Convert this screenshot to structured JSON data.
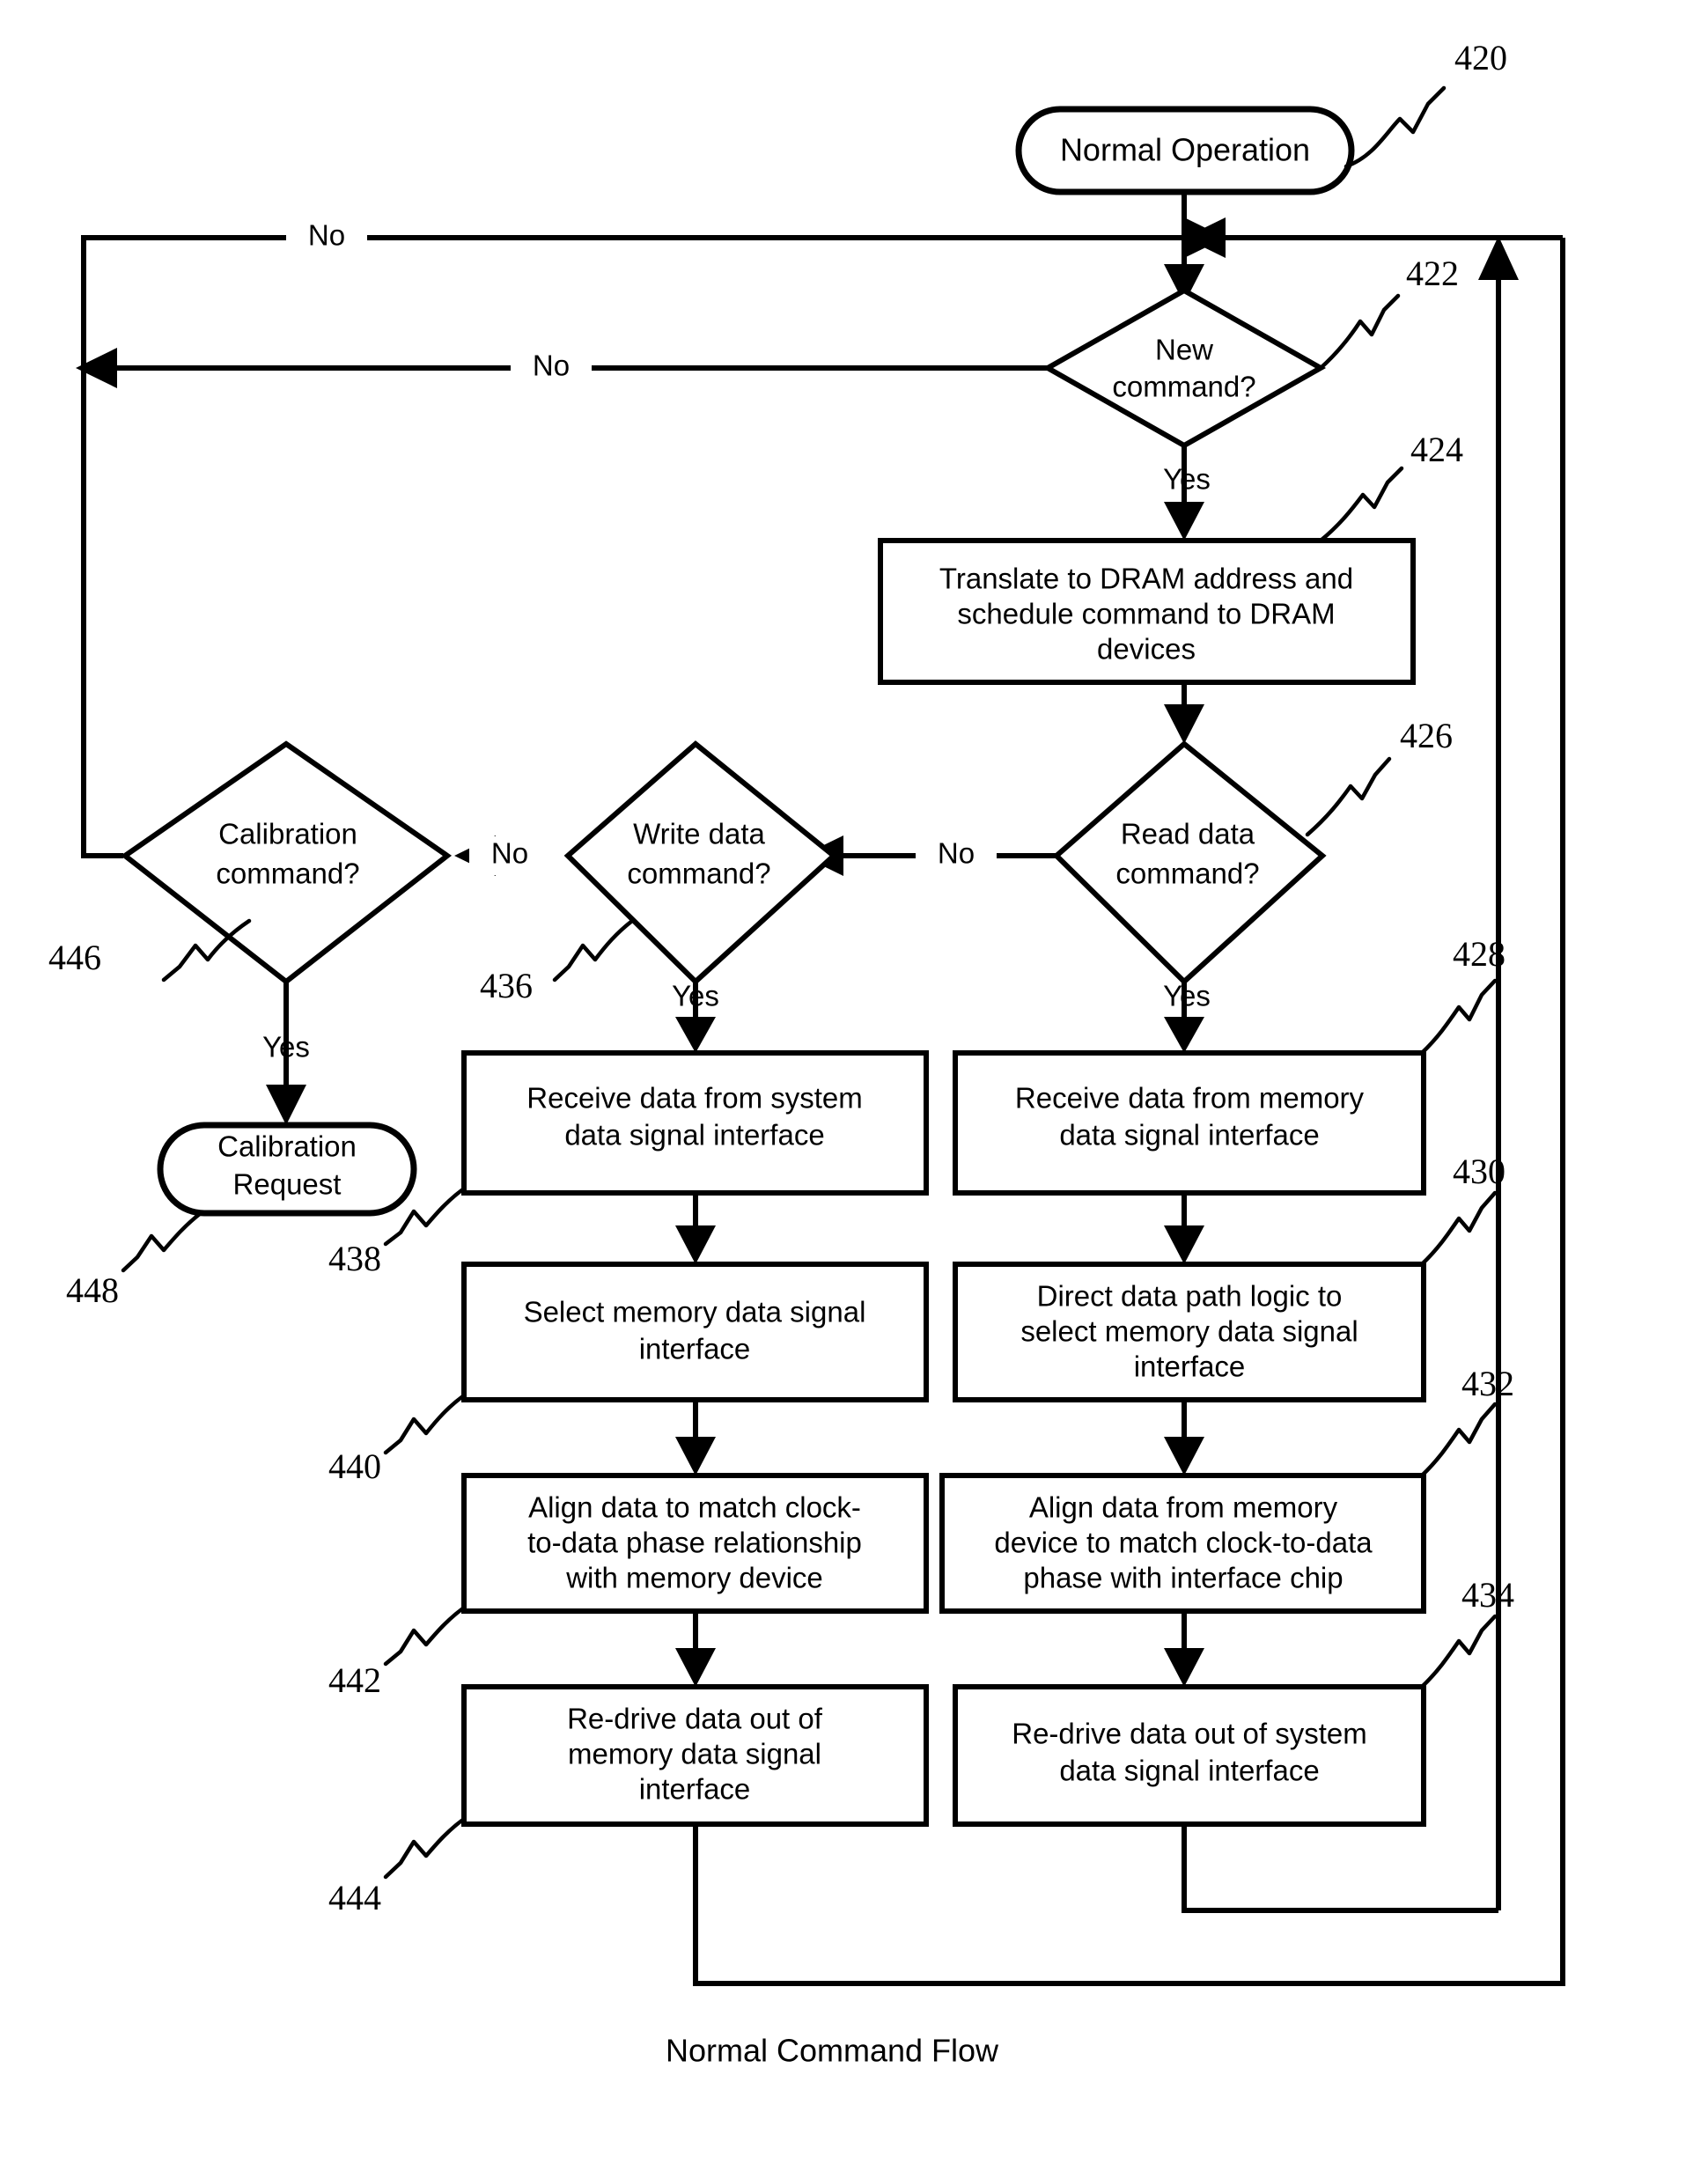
{
  "figure": {
    "caption": "Normal Command Flow",
    "edge_labels": {
      "no": "No",
      "yes": "Yes"
    }
  },
  "nodes": {
    "normal_operation": {
      "label": "Normal Operation",
      "ref": "420",
      "shape": "terminator"
    },
    "new_command": {
      "label_line1": "New",
      "label_line2": "command?",
      "ref": "422",
      "shape": "decision"
    },
    "translate": {
      "label_line1": "Translate to DRAM address and",
      "label_line2": "schedule command to DRAM",
      "label_line3": "devices",
      "ref": "424",
      "shape": "process"
    },
    "read_data_command": {
      "label_line1": "Read data",
      "label_line2": "command?",
      "ref": "426",
      "shape": "decision"
    },
    "write_data_command": {
      "label_line1": "Write data",
      "label_line2": "command?",
      "ref": "436",
      "shape": "decision"
    },
    "calibration_command": {
      "label_line1": "Calibration",
      "label_line2": "command?",
      "ref": "446",
      "shape": "decision"
    },
    "calibration_request": {
      "label_line1": "Calibration",
      "label_line2": "Request",
      "ref": "448",
      "shape": "terminator"
    },
    "receive_memory": {
      "label_line1": "Receive data from memory",
      "label_line2": "data signal interface",
      "ref": "428",
      "shape": "process"
    },
    "direct_path": {
      "label_line1": "Direct data path logic to",
      "label_line2": "select memory data signal",
      "label_line3": "interface",
      "ref": "430",
      "shape": "process"
    },
    "align_memory": {
      "label_line1": "Align data from memory",
      "label_line2": "device to match clock-to-data",
      "label_line3": "phase with interface chip",
      "ref": "432",
      "shape": "process"
    },
    "redrive_system": {
      "label_line1": "Re-drive data out of system",
      "label_line2": "data signal interface",
      "ref": "434",
      "shape": "process"
    },
    "receive_system": {
      "label_line1": "Receive data from system",
      "label_line2": "data signal interface",
      "ref": "438",
      "shape": "process"
    },
    "select_memory": {
      "label_line1": "Select memory data signal",
      "label_line2": "interface",
      "ref": "440",
      "shape": "process"
    },
    "align_system": {
      "label_line1": "Align data to match clock-",
      "label_line2": "to-data phase relationship",
      "label_line3": "with memory device",
      "ref": "442",
      "shape": "process"
    },
    "redrive_memory": {
      "label_line1": "Re-drive data out of",
      "label_line2": "memory data signal",
      "label_line3": "interface",
      "ref": "444",
      "shape": "process"
    }
  },
  "edges": [
    {
      "from": "normal_operation",
      "to": "new_command",
      "label": ""
    },
    {
      "from": "new_command",
      "to": "translate",
      "label": "Yes"
    },
    {
      "from": "new_command",
      "to": "loop_top_left",
      "label": "No"
    },
    {
      "from": "translate",
      "to": "read_data_command",
      "label": ""
    },
    {
      "from": "read_data_command",
      "to": "write_data_command",
      "label": "No"
    },
    {
      "from": "read_data_command",
      "to": "receive_memory",
      "label": "Yes"
    },
    {
      "from": "write_data_command",
      "to": "calibration_command",
      "label": "No"
    },
    {
      "from": "write_data_command",
      "to": "receive_system",
      "label": "Yes"
    },
    {
      "from": "calibration_command",
      "to": "calibration_request",
      "label": "Yes"
    },
    {
      "from": "calibration_command",
      "to": "loop_top_outer",
      "label": "No"
    },
    {
      "from": "receive_memory",
      "to": "direct_path",
      "label": ""
    },
    {
      "from": "direct_path",
      "to": "align_memory",
      "label": ""
    },
    {
      "from": "align_memory",
      "to": "redrive_system",
      "label": ""
    },
    {
      "from": "redrive_system",
      "to": "normal_operation_return",
      "label": ""
    },
    {
      "from": "receive_system",
      "to": "select_memory",
      "label": ""
    },
    {
      "from": "select_memory",
      "to": "align_system",
      "label": ""
    },
    {
      "from": "align_system",
      "to": "redrive_memory",
      "label": ""
    },
    {
      "from": "redrive_memory",
      "to": "normal_operation_return",
      "label": ""
    }
  ],
  "colors": {
    "stroke": "#000000",
    "fill": "#ffffff",
    "text": "#000000"
  }
}
